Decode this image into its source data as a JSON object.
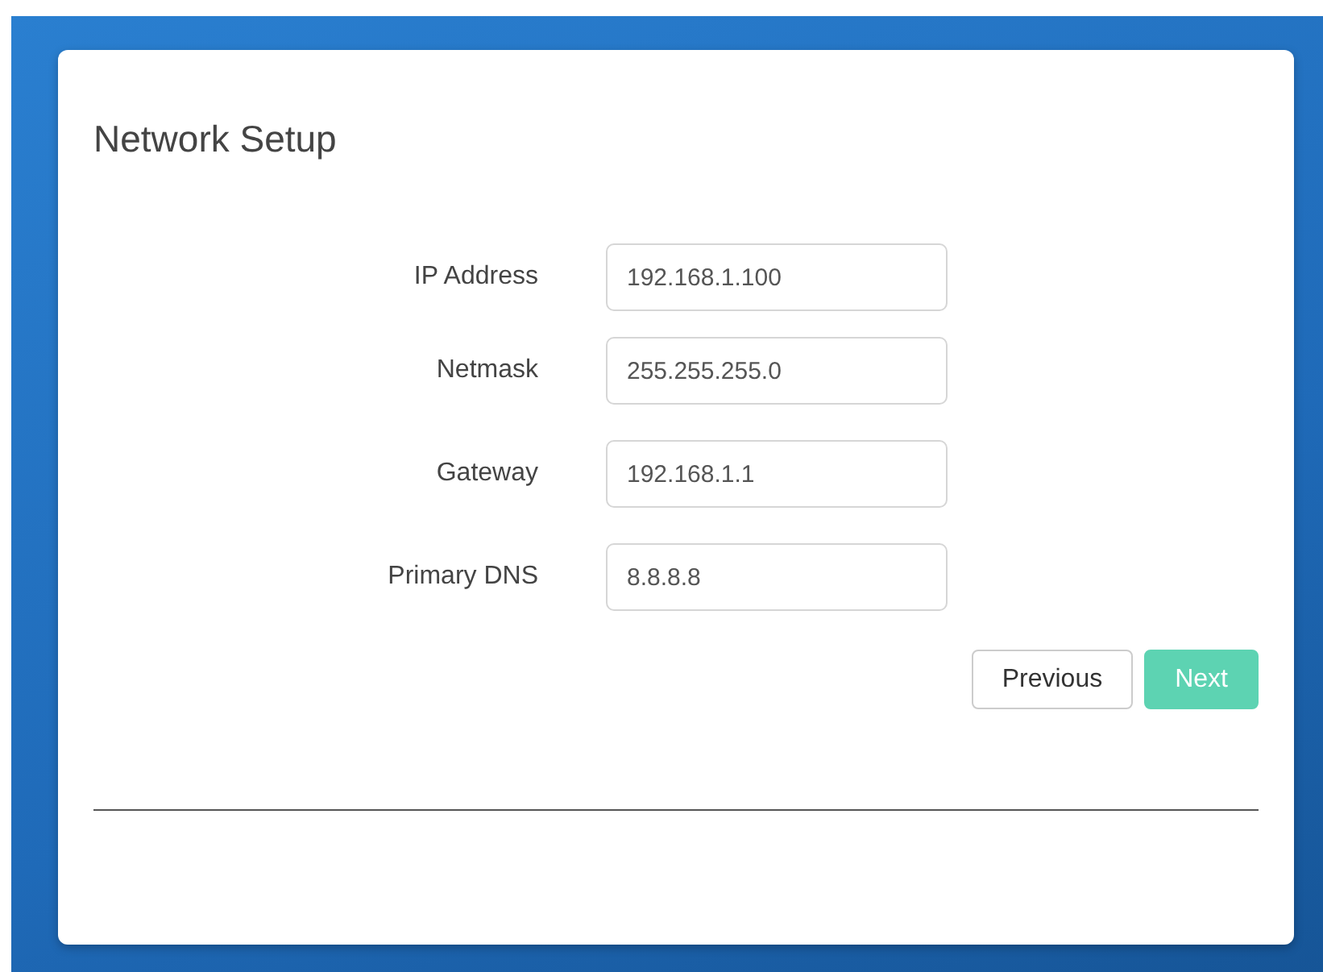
{
  "dialog": {
    "title": "Network Setup",
    "fields": [
      {
        "label": "IP Address",
        "value": "192.168.1.100"
      },
      {
        "label": "Netmask",
        "value": "255.255.255.0"
      },
      {
        "label": "Gateway",
        "value": "192.168.1.1"
      },
      {
        "label": "Primary DNS",
        "value": "8.8.8.8"
      }
    ],
    "buttons": [
      {
        "label": "Previous",
        "kind": "secondary"
      },
      {
        "label": "Next",
        "kind": "primary"
      }
    ]
  }
}
